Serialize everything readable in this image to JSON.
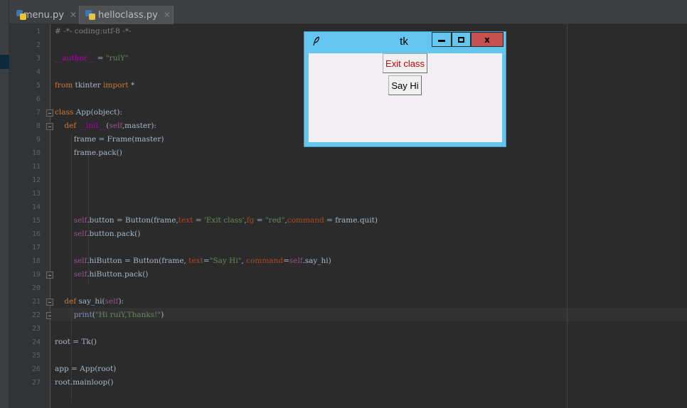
{
  "tabs": [
    {
      "label": "menu.py",
      "active": false
    },
    {
      "label": "helloclass.py",
      "active": true
    }
  ],
  "line_numbers": [
    "1",
    "2",
    "3",
    "4",
    "5",
    "6",
    "7",
    "8",
    "9",
    "10",
    "11",
    "12",
    "13",
    "14",
    "15",
    "16",
    "17",
    "18",
    "19",
    "20",
    "21",
    "22",
    "23",
    "24",
    "25",
    "26",
    "27"
  ],
  "code": [
    "# -*- coding:utf-8 -*-",
    "",
    "__author__ = \"ruiY\"",
    "",
    "from tkinter import *",
    "",
    "class App(object):",
    "    def __init__(self,master):",
    "        frame = Frame(master)",
    "        frame.pack()",
    "",
    "",
    "",
    "",
    "        self.button = Button(frame,text = 'Exit class',fg = \"red\",command = frame.quit)",
    "        self.button.pack()",
    "",
    "        self.hiButton = Button(frame, text=\"Say Hi\", command=self.say_hi)",
    "        self.hiButton.pack()",
    "",
    "    def say_hi(self):",
    "        print(\"Hi ruiY,Thanks!\")",
    "",
    "root = Tk()",
    "",
    "app = App(root)",
    "root.mainloop()"
  ],
  "tk_window": {
    "title": "tk",
    "close_glyph": "x",
    "exit_button_label": "Exit class",
    "exit_button_color": "#cc0000",
    "hi_button_label": "Say Hi"
  },
  "colors": {
    "editor_bg": "#2b2b2b",
    "keyword": "#cc7832",
    "string": "#6a8759",
    "self": "#94558d",
    "tk_titlebar": "#64c6ee",
    "tk_close": "#c75050"
  }
}
